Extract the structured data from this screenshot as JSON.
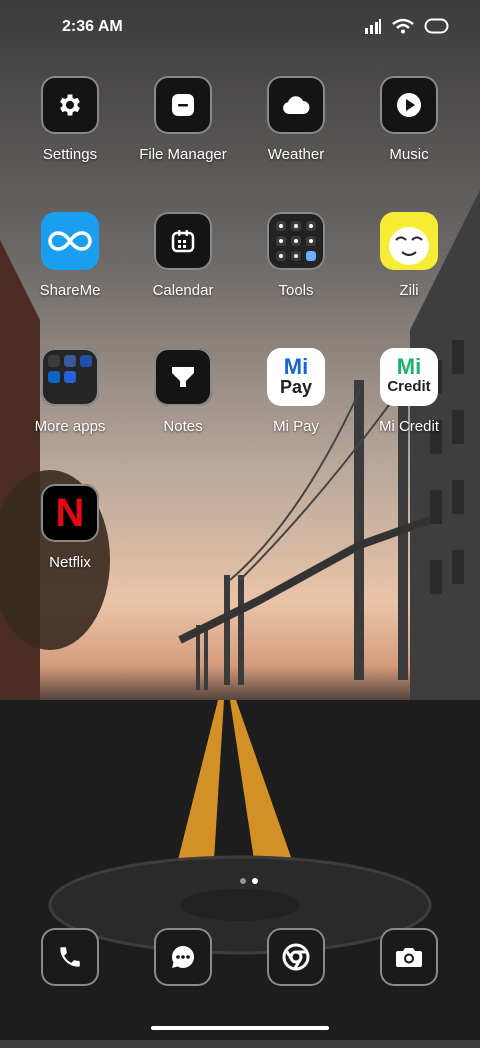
{
  "status_bar": {
    "time": "2:36 AM",
    "icons": [
      "signal-icon",
      "wifi-icon",
      "battery-icon"
    ]
  },
  "apps": [
    {
      "name": "Settings",
      "icon": "gear-icon",
      "col": 0,
      "row": 0
    },
    {
      "name": "File Manager",
      "icon": "folder-icon",
      "col": 1,
      "row": 0
    },
    {
      "name": "Weather",
      "icon": "cloud-icon",
      "col": 2,
      "row": 0
    },
    {
      "name": "Music",
      "icon": "play-icon",
      "col": 3,
      "row": 0
    },
    {
      "name": "ShareMe",
      "icon": "infinity-icon",
      "col": 0,
      "row": 1
    },
    {
      "name": "Calendar",
      "icon": "calendar-icon",
      "col": 1,
      "row": 1
    },
    {
      "name": "Tools",
      "icon": "tools-grid-icon",
      "col": 2,
      "row": 1
    },
    {
      "name": "Zili",
      "icon": "zili-face-icon",
      "col": 3,
      "row": 1
    },
    {
      "name": "More apps",
      "icon": "folder-grid-icon",
      "col": 0,
      "row": 2
    },
    {
      "name": "Notes",
      "icon": "notes-icon",
      "col": 1,
      "row": 2
    },
    {
      "name": "Mi Pay",
      "icon": "mi-pay-icon",
      "col": 2,
      "row": 2
    },
    {
      "name": "Mi Credit",
      "icon": "mi-credit-icon",
      "col": 3,
      "row": 2
    },
    {
      "name": "Netflix",
      "icon": "netflix-icon",
      "col": 0,
      "row": 3
    }
  ],
  "icon_text": {
    "mi_pay": {
      "top": "Mi",
      "bottom": "Pay"
    },
    "mi_credit": {
      "top": "Mi",
      "bottom": "Credit"
    },
    "netflix": "N"
  },
  "dock": [
    {
      "name": "Phone",
      "icon": "phone-icon"
    },
    {
      "name": "Messaging",
      "icon": "message-icon"
    },
    {
      "name": "Chrome",
      "icon": "chrome-icon"
    },
    {
      "name": "Camera",
      "icon": "camera-icon"
    }
  ],
  "page_indicator": {
    "pages": 2,
    "current": 2
  },
  "colors": {
    "label": "#ffffff",
    "shareme_bg": "#1a9ef0",
    "zili_bg": "#f7ec35",
    "mi_green": "#1bb36b",
    "mi_blue": "#1565d8",
    "netflix_red": "#e50914"
  }
}
